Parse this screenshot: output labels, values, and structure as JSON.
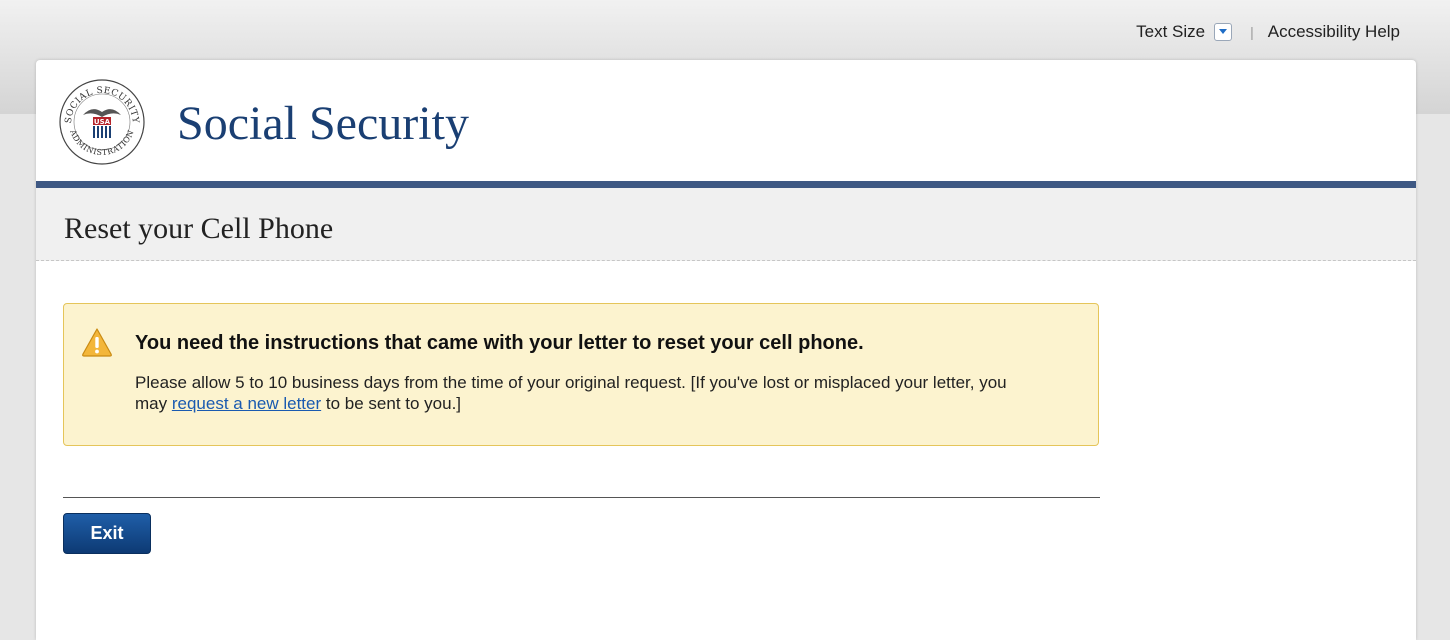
{
  "utility": {
    "text_size_label": "Text Size",
    "separator": "|",
    "accessibility_help": "Accessibility Help"
  },
  "header": {
    "site_title": "Social Security",
    "seal": {
      "top_arc": "SOCIAL SECURITY",
      "bottom_arc": "ADMINISTRATION",
      "center": "USA"
    }
  },
  "page": {
    "title": "Reset your Cell Phone"
  },
  "alert": {
    "icon": "warning-icon",
    "heading": "You need the instructions that came with your letter to reset your cell phone.",
    "body_before_link": "Please allow 5 to 10 business days from the time of your original request. [If you've lost or misplaced your letter, you may ",
    "link_text": "request a new letter",
    "body_after_link": " to be sent to you.]"
  },
  "actions": {
    "exit_label": "Exit"
  },
  "colors": {
    "brand_navy": "#1a3f73",
    "header_rule": "#3e5883",
    "alert_background": "#fcf3cf",
    "alert_border": "#e5c55a",
    "link": "#1a5ab0",
    "button": "#1f5ea8"
  }
}
